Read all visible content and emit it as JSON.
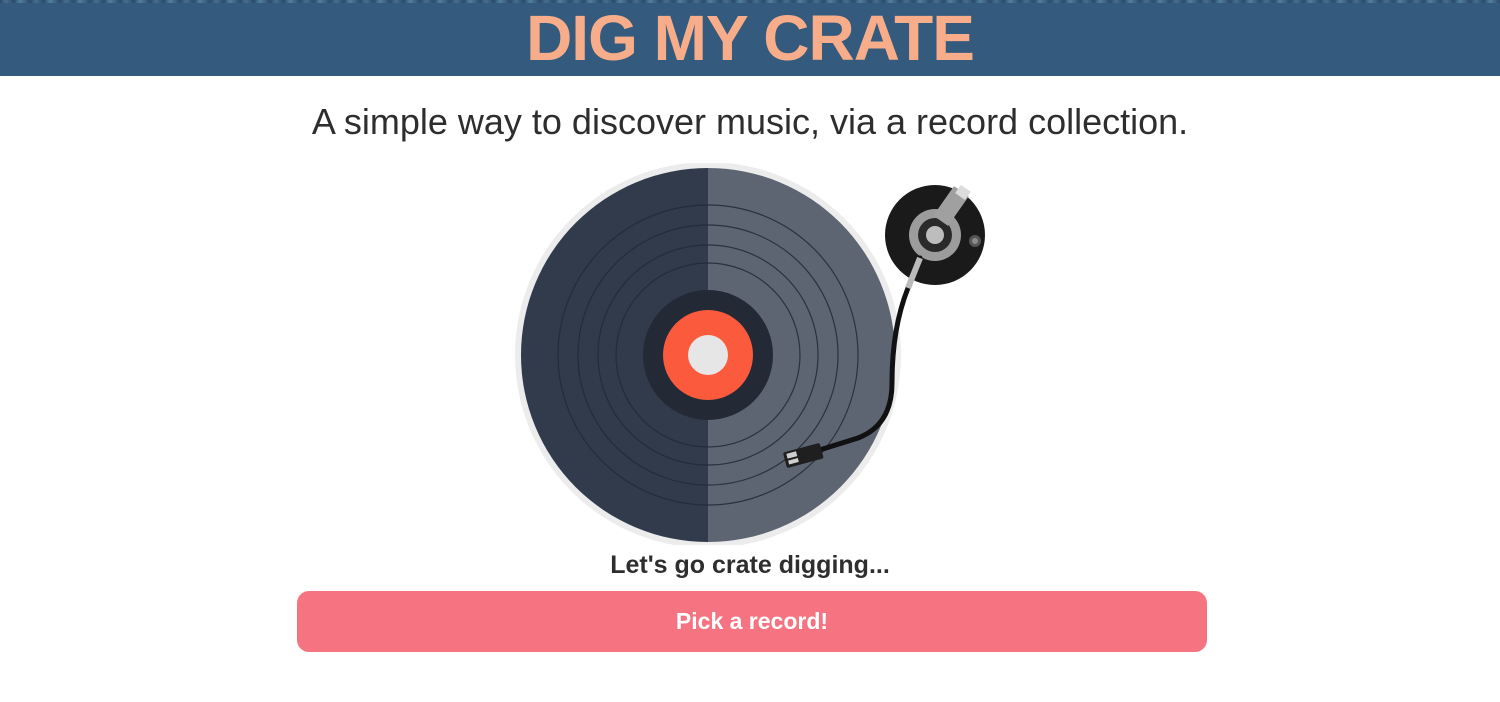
{
  "header": {
    "title": "DIG MY CRATE"
  },
  "main": {
    "tagline": "A simple way to discover music, via a record collection.",
    "cta_text": "Let's go crate digging...",
    "pick_button_label": "Pick a record!"
  },
  "illustration": {
    "name": "turntable",
    "icon": "vinyl-record-turntable"
  },
  "colors": {
    "header_bg": "#345a7d",
    "title": "#f8ad8a",
    "button_bg": "#f67381",
    "button_text": "#ffffff",
    "record_label": "#fb5a3d"
  }
}
